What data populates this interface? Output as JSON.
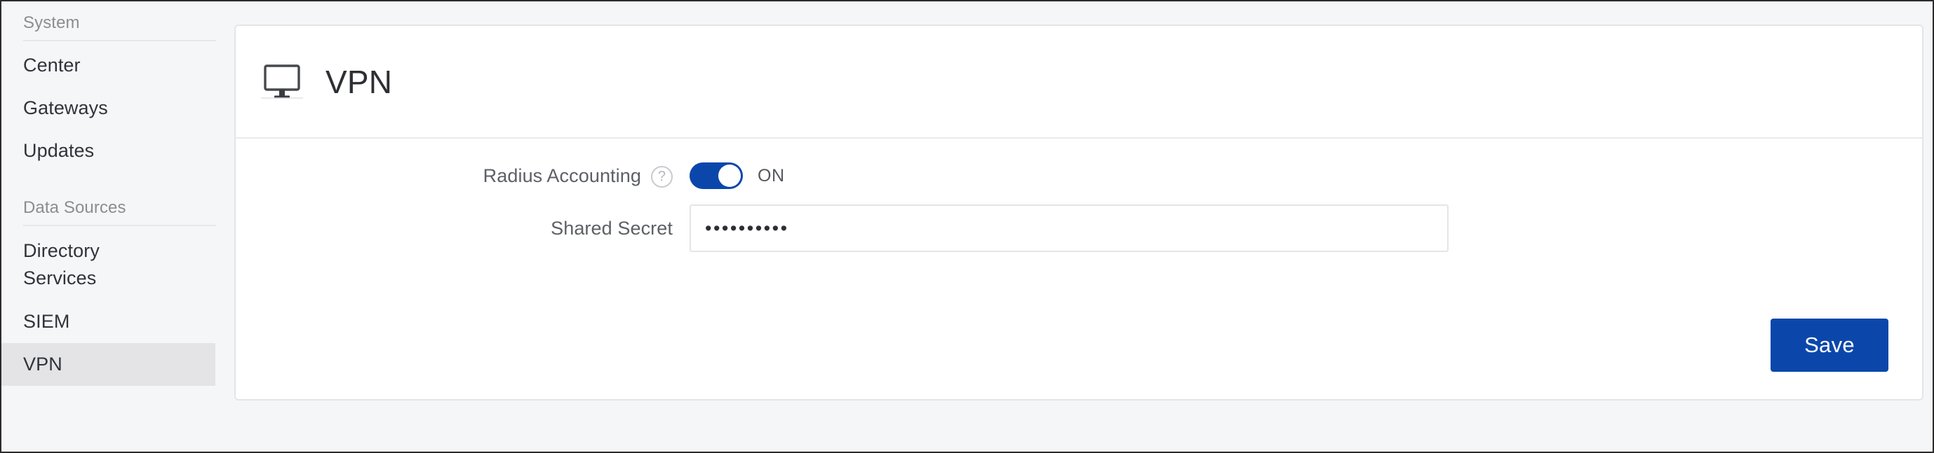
{
  "sidebar": {
    "sections": [
      {
        "title": "System",
        "items": [
          {
            "label": "Center",
            "active": false
          },
          {
            "label": "Gateways",
            "active": false
          },
          {
            "label": "Updates",
            "active": false
          }
        ]
      },
      {
        "title": "Data Sources",
        "items": [
          {
            "label": "Directory Services",
            "active": false
          },
          {
            "label": "SIEM",
            "active": false
          },
          {
            "label": "VPN",
            "active": true
          }
        ]
      }
    ],
    "active_item": "VPN",
    "active_highlight_color": "#e4e4e6"
  },
  "card": {
    "icon": "monitor-icon",
    "title": "VPN",
    "fields": {
      "radius_accounting": {
        "label": "Radius Accounting",
        "help_icon": "question-mark-icon",
        "help_glyph": "?",
        "toggle_state": "ON",
        "toggle_on": true,
        "toggle_color": "#0b47ab"
      },
      "shared_secret": {
        "label": "Shared Secret",
        "value": "••••••••••",
        "masked_char_count": 10,
        "input_type": "password",
        "placeholder": ""
      }
    },
    "save_label": "Save",
    "save_color": "#0b47ab"
  },
  "theme": {
    "background": "#f5f6f8",
    "card_background": "#ffffff",
    "border": "#e3e5e8",
    "accent": "#0b47ab",
    "text_primary": "#2d2f34",
    "text_secondary": "#5d6066",
    "text_muted": "#8b8d91"
  }
}
